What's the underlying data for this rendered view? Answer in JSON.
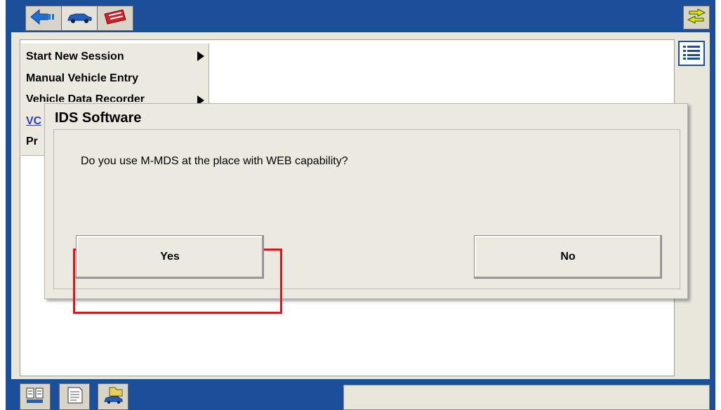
{
  "toolbar": {
    "tabs": [
      {
        "icon": "back-arrow-icon"
      },
      {
        "icon": "vehicle-icon"
      },
      {
        "icon": "toolbox-icon"
      }
    ],
    "swap_icon": "swap-arrows-icon"
  },
  "side": {
    "list_icon": "list-view-icon"
  },
  "menu": {
    "items": [
      {
        "label": "Start New Session"
      },
      {
        "label": "Manual Vehicle Entry"
      },
      {
        "label": "Vehicle Data Recorder"
      },
      {
        "label": "VC"
      },
      {
        "label": "Pr"
      }
    ]
  },
  "dialog": {
    "title": "IDS Software",
    "message": "Do you use M-MDS at the place with WEB capability?",
    "yes_label": "Yes",
    "no_label": "No",
    "highlight_color": "#e0151b"
  },
  "bottom": {
    "tabs": [
      {
        "icon": "data-grid-icon"
      },
      {
        "icon": "notes-icon"
      },
      {
        "icon": "vehicle-folder-icon"
      }
    ]
  },
  "colors": {
    "frame_blue": "#1b4f9a",
    "panel_beige": "#e9e7dc",
    "link_blue": "#2b3fb8"
  }
}
